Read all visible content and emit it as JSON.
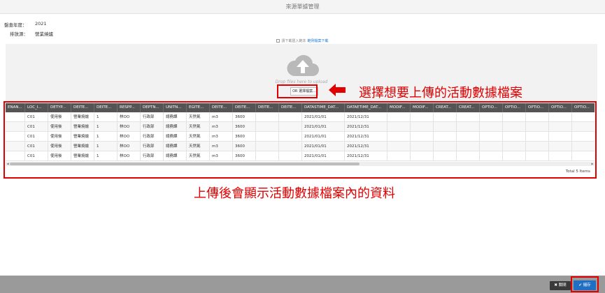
{
  "window": {
    "title": "來源單據管理"
  },
  "meta": [
    {
      "label": "盤查年度：",
      "value": "2021"
    },
    {
      "label": "排放源：",
      "value": "營業燒爐"
    }
  ],
  "template_download": {
    "text": "請下載匯入範本",
    "link": "範例檔案下載"
  },
  "dropzone": {
    "text": "Drop files here to upload",
    "browse_label": "OR 選擇檔案..."
  },
  "annotations": {
    "top": "選擇想要上傳的活動數據檔案",
    "bottom": "上傳後會顯示活動數據檔案內的資料"
  },
  "grid": {
    "columns": [
      "ENAN...",
      "LOC_I...",
      "DETYP...",
      "DEITE...",
      "DEITE...",
      "RESPP...",
      "DEPTN...",
      "UNITN...",
      "EGITE...",
      "DEITE...",
      "DEITE...",
      "DEITE...",
      "DEITE...",
      "DATASTIME_DAT...",
      "DATAETIME_DAT...",
      "MODIF...",
      "MODIF...",
      "CREAT...",
      "CREAT...",
      "OPTIO...",
      "OPTIO...",
      "OPTIO...",
      "OPTIO...",
      "OPTIO..."
    ],
    "rows": [
      [
        "",
        "C01",
        "使用後",
        "營業燒爐",
        "1",
        "林OO",
        "行政部",
        "總務課",
        "天然氣",
        "m3",
        "3600",
        "",
        "",
        "2021/01/01",
        "2021/12/31",
        "",
        "",
        "",
        "",
        "",
        "",
        "",
        "",
        ""
      ],
      [
        "",
        "C01",
        "使用後",
        "營業燒爐",
        "1",
        "林OO",
        "行政部",
        "總務課",
        "天然氣",
        "m3",
        "3600",
        "",
        "",
        "2021/01/01",
        "2021/12/31",
        "",
        "",
        "",
        "",
        "",
        "",
        "",
        "",
        ""
      ],
      [
        "",
        "C01",
        "使用後",
        "營業燒爐",
        "1",
        "林OO",
        "行政部",
        "總務課",
        "天然氣",
        "m3",
        "3600",
        "",
        "",
        "2021/01/01",
        "2021/12/31",
        "",
        "",
        "",
        "",
        "",
        "",
        "",
        "",
        ""
      ],
      [
        "",
        "C01",
        "使用後",
        "營業燒爐",
        "1",
        "林OO",
        "行政部",
        "總務課",
        "天然氣",
        "m3",
        "3600",
        "",
        "",
        "2021/01/01",
        "2021/12/31",
        "",
        "",
        "",
        "",
        "",
        "",
        "",
        "",
        ""
      ],
      [
        "",
        "C01",
        "使用後",
        "營業燒爐",
        "1",
        "林OO",
        "行政部",
        "總務課",
        "天然氣",
        "m3",
        "3600",
        "",
        "",
        "2021/01/01",
        "2021/12/31",
        "",
        "",
        "",
        "",
        "",
        "",
        "",
        "",
        ""
      ]
    ],
    "total": "Total 5 Items"
  },
  "footer": {
    "close_label": "關閉",
    "save_label": "儲存"
  },
  "colors": {
    "accent": "#1f6fc4",
    "annotation": "#e00000",
    "grid_header": "#545454",
    "footer": "#9a9a9a"
  }
}
